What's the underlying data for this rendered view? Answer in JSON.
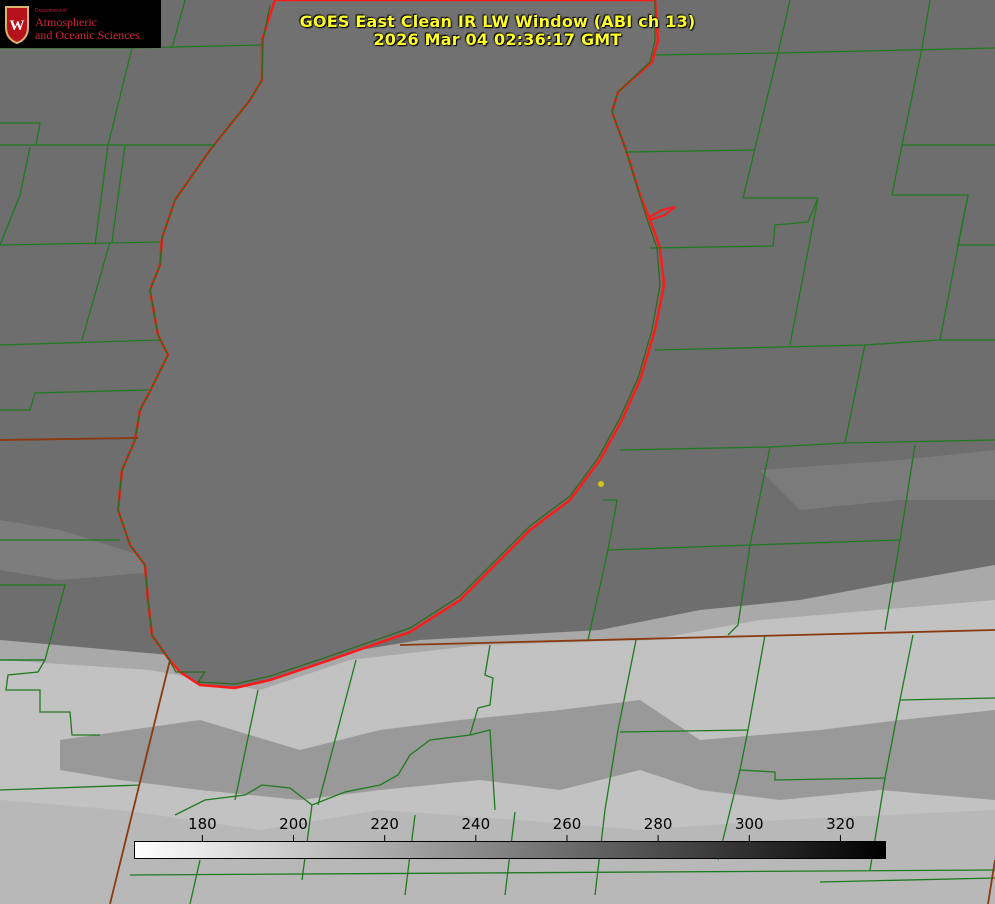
{
  "title": {
    "line1": "GOES East Clean IR LW Window (ABI ch 13)",
    "line2": "2026 Mar 04 02:36:17 GMT"
  },
  "logo": {
    "department": "Department of",
    "line1": "Atmospheric",
    "line2": "and Oceanic Sciences",
    "crest_letter": "W"
  },
  "colorbar": {
    "ticks": [
      "180",
      "200",
      "220",
      "240",
      "260",
      "280",
      "300",
      "320"
    ],
    "range": [
      165,
      330
    ],
    "colors": {
      "min": "#ffffff",
      "max": "#000000"
    }
  },
  "colors": {
    "lake_shoreline": "#ff1a1a",
    "county_lines": "#1f7a1f",
    "state_lines": "#8a3a10",
    "marker": "#d2c21a"
  }
}
